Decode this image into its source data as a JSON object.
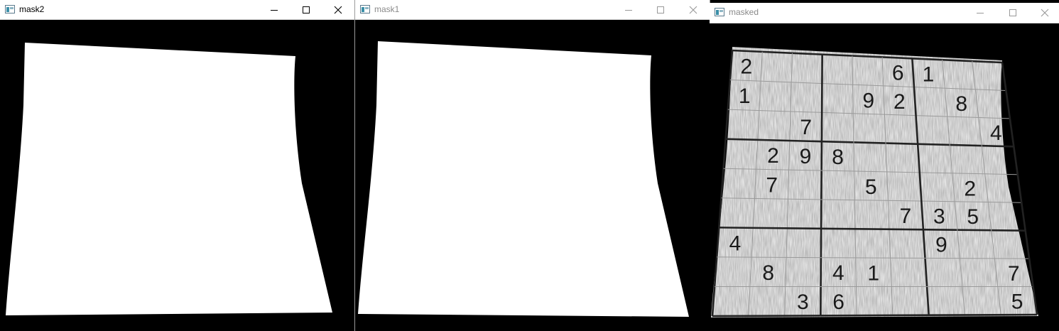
{
  "windows": [
    {
      "id": "mask2",
      "title": "mask2",
      "active": true
    },
    {
      "id": "mask1",
      "title": "mask1",
      "active": false
    },
    {
      "id": "masked",
      "title": "masked",
      "active": false
    }
  ],
  "icons": {
    "app": "app-window-icon",
    "minimize": "minimize-icon",
    "maximize": "maximize-icon",
    "close": "close-icon"
  },
  "colors": {
    "mask_fill": "#ffffff",
    "background": "#000000",
    "paper": "#ececec",
    "grid_line": "#9a9a9a",
    "grid_line_bold": "#222222",
    "digit": "#1a1a1a"
  },
  "sudoku": {
    "rows": [
      [
        "2",
        "",
        "",
        "",
        "",
        "6",
        "1",
        "",
        ""
      ],
      [
        "1",
        "",
        "",
        "",
        "9",
        "2",
        "",
        "8",
        ""
      ],
      [
        "",
        "",
        "7",
        "",
        "",
        "",
        "",
        "",
        "4"
      ],
      [
        "",
        "2",
        "9",
        "8",
        "",
        "",
        "",
        "",
        ""
      ],
      [
        "",
        "7",
        "",
        "",
        "5",
        "",
        "",
        "2",
        ""
      ],
      [
        "",
        "",
        "",
        "",
        "",
        "7",
        "3",
        "5",
        ""
      ],
      [
        "4",
        "",
        "",
        "",
        "",
        "",
        "9",
        "",
        ""
      ],
      [
        "",
        "8",
        "",
        "4",
        "1",
        "",
        "",
        "",
        "7"
      ],
      [
        "",
        "",
        "3",
        "6",
        "",
        "",
        "",
        "",
        "5"
      ]
    ]
  }
}
